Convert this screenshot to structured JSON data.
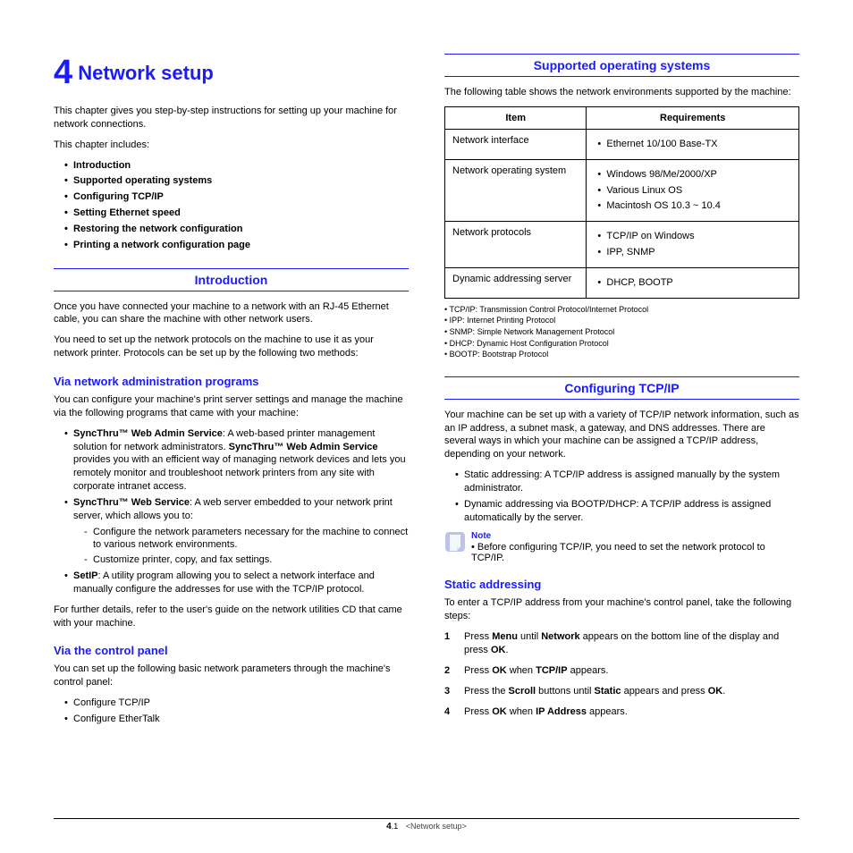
{
  "chapter": {
    "number": "4",
    "title": "Network setup"
  },
  "left": {
    "intro_p1": "This chapter gives you step-by-step instructions for setting up your machine for network connections.",
    "intro_p2": "This chapter includes:",
    "toc": [
      "Introduction",
      "Supported operating systems",
      "Configuring TCP/IP",
      "Setting Ethernet speed",
      "Restoring the network configuration",
      "Printing a network configuration page"
    ],
    "section_introduction": "Introduction",
    "intro_body1": "Once you have connected your machine to a network with an RJ-45 Ethernet cable, you can share the machine with other network users.",
    "intro_body2": "You need to set up the network protocols on the machine to use it as your network printer. Protocols can be set up by the following two methods:",
    "sub_via_admin": "Via network administration programs",
    "via_admin_p": "You can configure your machine's print server settings and manage the machine via the following programs that came with your machine:",
    "via_admin_items": {
      "a_pre": "SyncThru™ Web Admin Service",
      "a_post": ": A web-based printer management solution for network administrators. ",
      "a_bold2": "SyncThru™ Web Admin Service",
      "a_tail": " provides you with an efficient way of managing network devices and lets you remotely monitor and troubleshoot network printers from any site with corporate intranet access.",
      "b_pre": "SyncThru™ Web Service",
      "b_post": ": A web server embedded to your network print server, which allows you to:",
      "b_sub1": "Configure the network parameters necessary for the machine to connect to various network environments.",
      "b_sub2": "Customize printer, copy, and fax settings.",
      "c_pre": "SetIP",
      "c_post": ": A utility program allowing you to select a network interface and manually configure the addresses for use with the TCP/IP protocol."
    },
    "via_admin_tail": "For further details, refer to the user's guide on the network utilities CD that came with your machine.",
    "sub_via_panel": "Via the control panel",
    "via_panel_p": "You can set up the following basic network parameters through the machine's control panel:",
    "via_panel_items": [
      "Configure TCP/IP",
      "Configure EtherTalk"
    ]
  },
  "right": {
    "section_supported": "Supported operating systems",
    "supported_p": "The following table shows the network environments supported by the machine:",
    "table": {
      "head": [
        "Item",
        "Requirements"
      ],
      "rows": [
        {
          "item": "Network interface",
          "reqs": [
            "Ethernet 10/100 Base-TX"
          ]
        },
        {
          "item": "Network operating system",
          "reqs": [
            "Windows 98/Me/2000/XP",
            "Various Linux OS",
            "Macintosh OS 10.3 ~ 10.4"
          ]
        },
        {
          "item": "Network protocols",
          "reqs": [
            "TCP/IP on Windows",
            "IPP, SNMP"
          ]
        },
        {
          "item": "Dynamic addressing server",
          "reqs": [
            "DHCP, BOOTP"
          ]
        }
      ]
    },
    "footnotes": [
      "TCP/IP: Transmission Control Protocol/Internet Protocol",
      "IPP: Internet Printing Protocol",
      "SNMP: Simple Network Management Protocol",
      "DHCP: Dynamic Host Configuration Protocol",
      "BOOTP: Bootstrap Protocol"
    ],
    "section_configuring": "Configuring TCP/IP",
    "config_p": "Your machine can be set up with a variety of TCP/IP network information, such as an IP address, a subnet mask, a gateway, and DNS addresses. There are several ways in which your machine can be assigned a TCP/IP address, depending on your network.",
    "config_items": [
      "Static addressing: A TCP/IP address is assigned manually by the system administrator.",
      "Dynamic addressing via BOOTP/DHCP: A TCP/IP address is assigned automatically by the server."
    ],
    "note_label": "Note",
    "note_text": "Before configuring TCP/IP, you need to set the network protocol to TCP/IP.",
    "sub_static": "Static addressing",
    "static_p": "To enter a TCP/IP address from your machine's control panel, take the following steps:",
    "steps": {
      "s1_a": "Press ",
      "s1_b": "Menu",
      "s1_c": " until ",
      "s1_d": "Network",
      "s1_e": " appears on the bottom line of the display and press ",
      "s1_f": "OK",
      "s1_g": ".",
      "s2_a": "Press ",
      "s2_b": "OK",
      "s2_c": " when ",
      "s2_d": "TCP/IP",
      "s2_e": " appears.",
      "s3_a": "Press the ",
      "s3_b": "Scroll",
      "s3_c": " buttons until ",
      "s3_d": "Static",
      "s3_e": " appears and press ",
      "s3_f": "OK",
      "s3_g": ".",
      "s4_a": "Press ",
      "s4_b": "OK",
      "s4_c": " when ",
      "s4_d": "IP Address",
      "s4_e": " appears."
    }
  },
  "footer": {
    "page_num": "4",
    "page_sub": ".1",
    "title": "<Network setup>"
  }
}
